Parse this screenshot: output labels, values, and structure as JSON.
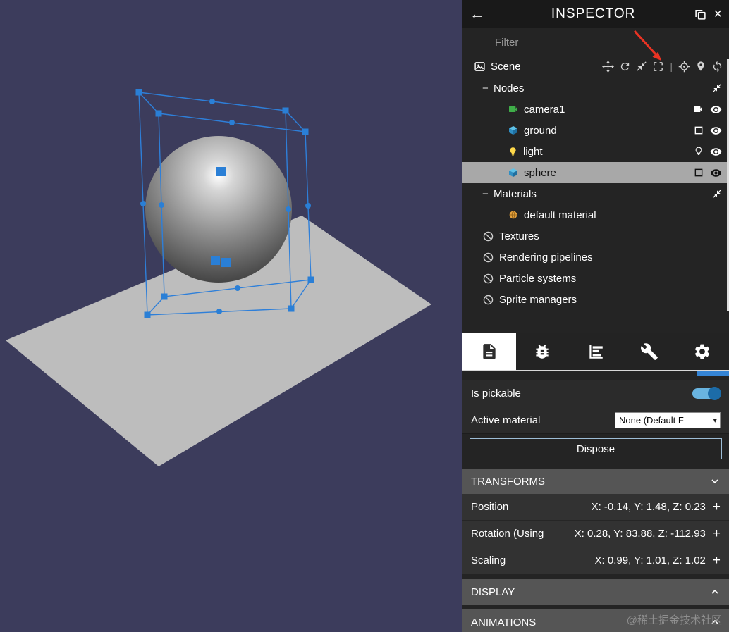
{
  "icons": {
    "back": "←",
    "close": "×",
    "minus": "−",
    "separator": "|",
    "plus": "+",
    "select_caret": "▾"
  },
  "inspector": {
    "title": "INSPECTOR",
    "filter_placeholder": "Filter",
    "scene": {
      "label": "Scene"
    },
    "explorer": {
      "nodes": {
        "label": "Nodes",
        "items": [
          {
            "label": "camera1"
          },
          {
            "label": "ground"
          },
          {
            "label": "light"
          },
          {
            "label": "sphere",
            "selected": true
          }
        ]
      },
      "materials": {
        "label": "Materials",
        "items": [
          {
            "label": "default material"
          }
        ]
      },
      "empty_groups": [
        {
          "label": "Textures"
        },
        {
          "label": "Rendering pipelines"
        },
        {
          "label": "Particle systems"
        },
        {
          "label": "Sprite managers"
        }
      ]
    },
    "properties": {
      "is_pickable": {
        "label": "Is pickable",
        "value": true
      },
      "active_material": {
        "label": "Active material",
        "value": "None (Default F"
      },
      "dispose_label": "Dispose",
      "sections": {
        "transforms": {
          "label": "TRANSFORMS",
          "rows": [
            {
              "label": "Position",
              "value": "X: -0.14, Y: 1.48, Z: 0.23"
            },
            {
              "label": "Rotation (Using",
              "value": "X: 0.28, Y: 83.88, Z: -112.93"
            },
            {
              "label": "Scaling",
              "value": "X: 0.99, Y: 1.01, Z: 1.02"
            }
          ]
        },
        "display": {
          "label": "DISPLAY"
        },
        "animations": {
          "label": "ANIMATIONS"
        }
      }
    }
  },
  "watermark": "@稀土掘金技术社区",
  "colors": {
    "viewport_bg": "#3c3c5c",
    "gizmo_blue": "#2a7fd6",
    "selection_gray": "#a8a8a8",
    "accent_blue": "#3584d4",
    "annotation_red": "#ea3323"
  }
}
